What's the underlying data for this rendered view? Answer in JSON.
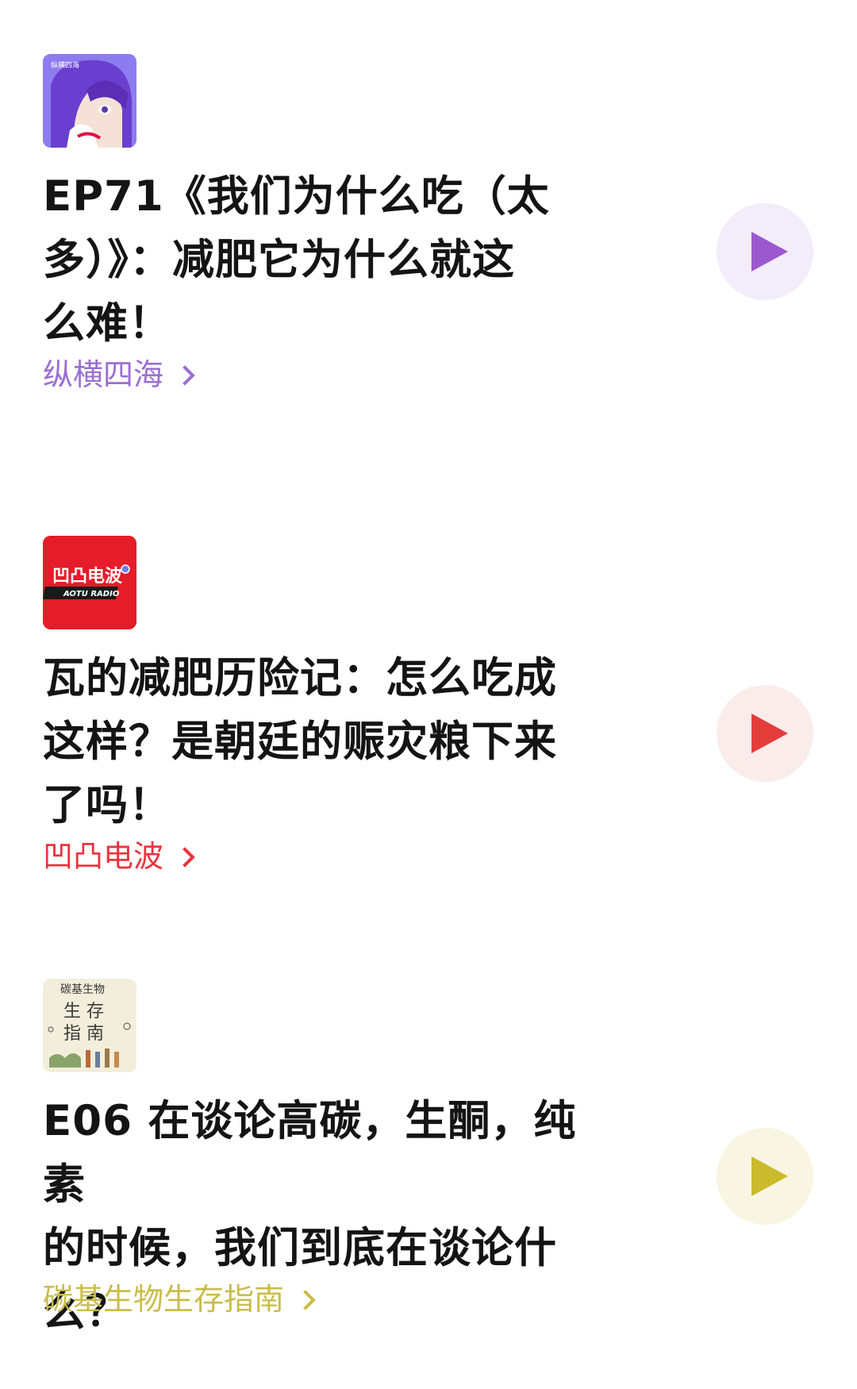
{
  "episodes": [
    {
      "cover_label": "纵横四海",
      "cover_art": "anime-girl-purple-hair",
      "title_lines": [
        "EP71《我们为什么吃（太",
        "多）》：减肥它为什么就这",
        "么难！"
      ],
      "channel": "纵横四海",
      "accent": "#9a6fd0",
      "play_bg": "#f3ecfa",
      "play_color": "#9b59d0"
    },
    {
      "cover_label": "凹凸电波",
      "cover_sub": "AOTU RADIO",
      "title_lines": [
        "瓦的减肥历险记：怎么吃成",
        "这样？是朝廷的赈灾粮下来",
        "了吗！"
      ],
      "channel": "凹凸电波",
      "accent": "#e8343f",
      "play_bg": "#fbecec",
      "play_color": "#e53c3c"
    },
    {
      "cover_label_top": "碳基生物",
      "cover_label_main": "生 存 指 南",
      "title_lines": [
        "E06 在谈论高碳，生酮，纯素",
        "的时候，我们到底在谈论什",
        "么？"
      ],
      "channel": "碳基生物生存指南",
      "accent": "#c9bd4a",
      "play_bg": "#f8f6e2",
      "play_color": "#cbbb2c"
    }
  ],
  "icons": {
    "play": "play-icon",
    "chevron": "chevron-right-icon"
  }
}
